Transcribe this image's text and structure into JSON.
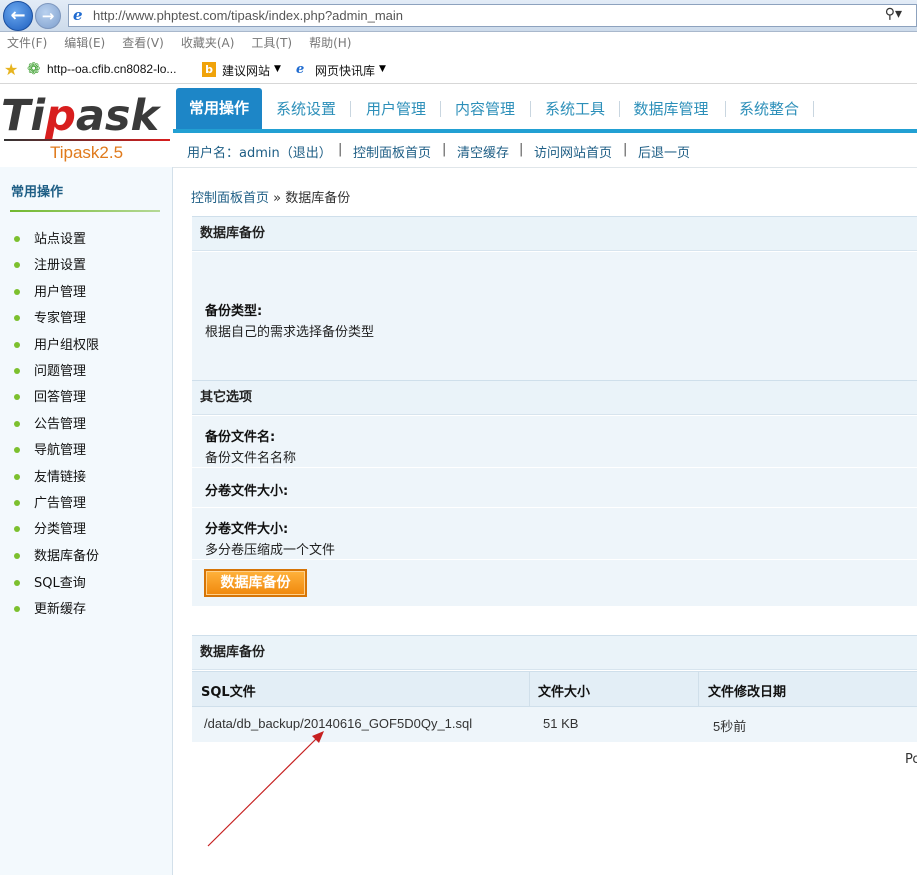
{
  "browser": {
    "url": "http://www.phptest.com/tipask/index.php?admin_main",
    "menu": [
      "文件(F)",
      "编辑(E)",
      "查看(V)",
      "收藏夹(A)",
      "工具(T)",
      "帮助(H)"
    ],
    "favorites": [
      "http--oa.cfib.cn8082-lo...",
      "建议网站",
      "网页快讯库"
    ]
  },
  "header": {
    "logo_left": "Ti",
    "logo_mid": "p",
    "logo_right": "ask",
    "version": "Tipask2.5",
    "tabs": [
      "常用操作",
      "系统设置",
      "用户管理",
      "内容管理",
      "系统工具",
      "数据库管理",
      "系统整合"
    ],
    "active_tab": 0
  },
  "userbar": {
    "user": "用户名：admin（退出）",
    "links": [
      "控制面板首页",
      "清空缓存",
      "访问网站首页",
      "后退一页"
    ],
    "sep": "|"
  },
  "sidebar": {
    "title": "常用操作",
    "items": [
      "站点设置",
      "注册设置",
      "用户管理",
      "专家管理",
      "用户组权限",
      "问题管理",
      "回答管理",
      "公告管理",
      "导航管理",
      "友情链接",
      "广告管理",
      "分类管理",
      "数据库备份",
      "SQL查询",
      "更新缓存"
    ]
  },
  "main": {
    "breadcrumb_home": "控制面板首页",
    "breadcrumb_sep": "»",
    "breadcrumb_current": "数据库备份",
    "section1_title": "数据库备份",
    "backup_type_label": "备份类型:",
    "backup_type_desc": "根据自己的需求选择备份类型",
    "section2_title": "其它选项",
    "filename_label": "备份文件名:",
    "filename_desc": "备份文件名名称",
    "volume_label_1": "分卷文件大小:",
    "volume_label_2": "分卷文件大小:",
    "volume_desc": "多分卷压缩成一个文件",
    "submit_button": "数据库备份",
    "list_title": "数据库备份",
    "table": {
      "headers": [
        "SQL文件",
        "文件大小",
        "文件修改日期"
      ],
      "rows": [
        [
          "/data/db_backup/20140616_GOF5D0Qy_1.sql",
          "51 KB",
          "5秒前"
        ]
      ]
    },
    "page_hint": "Po"
  },
  "annotation": {
    "arrow_color": "#c62020"
  }
}
